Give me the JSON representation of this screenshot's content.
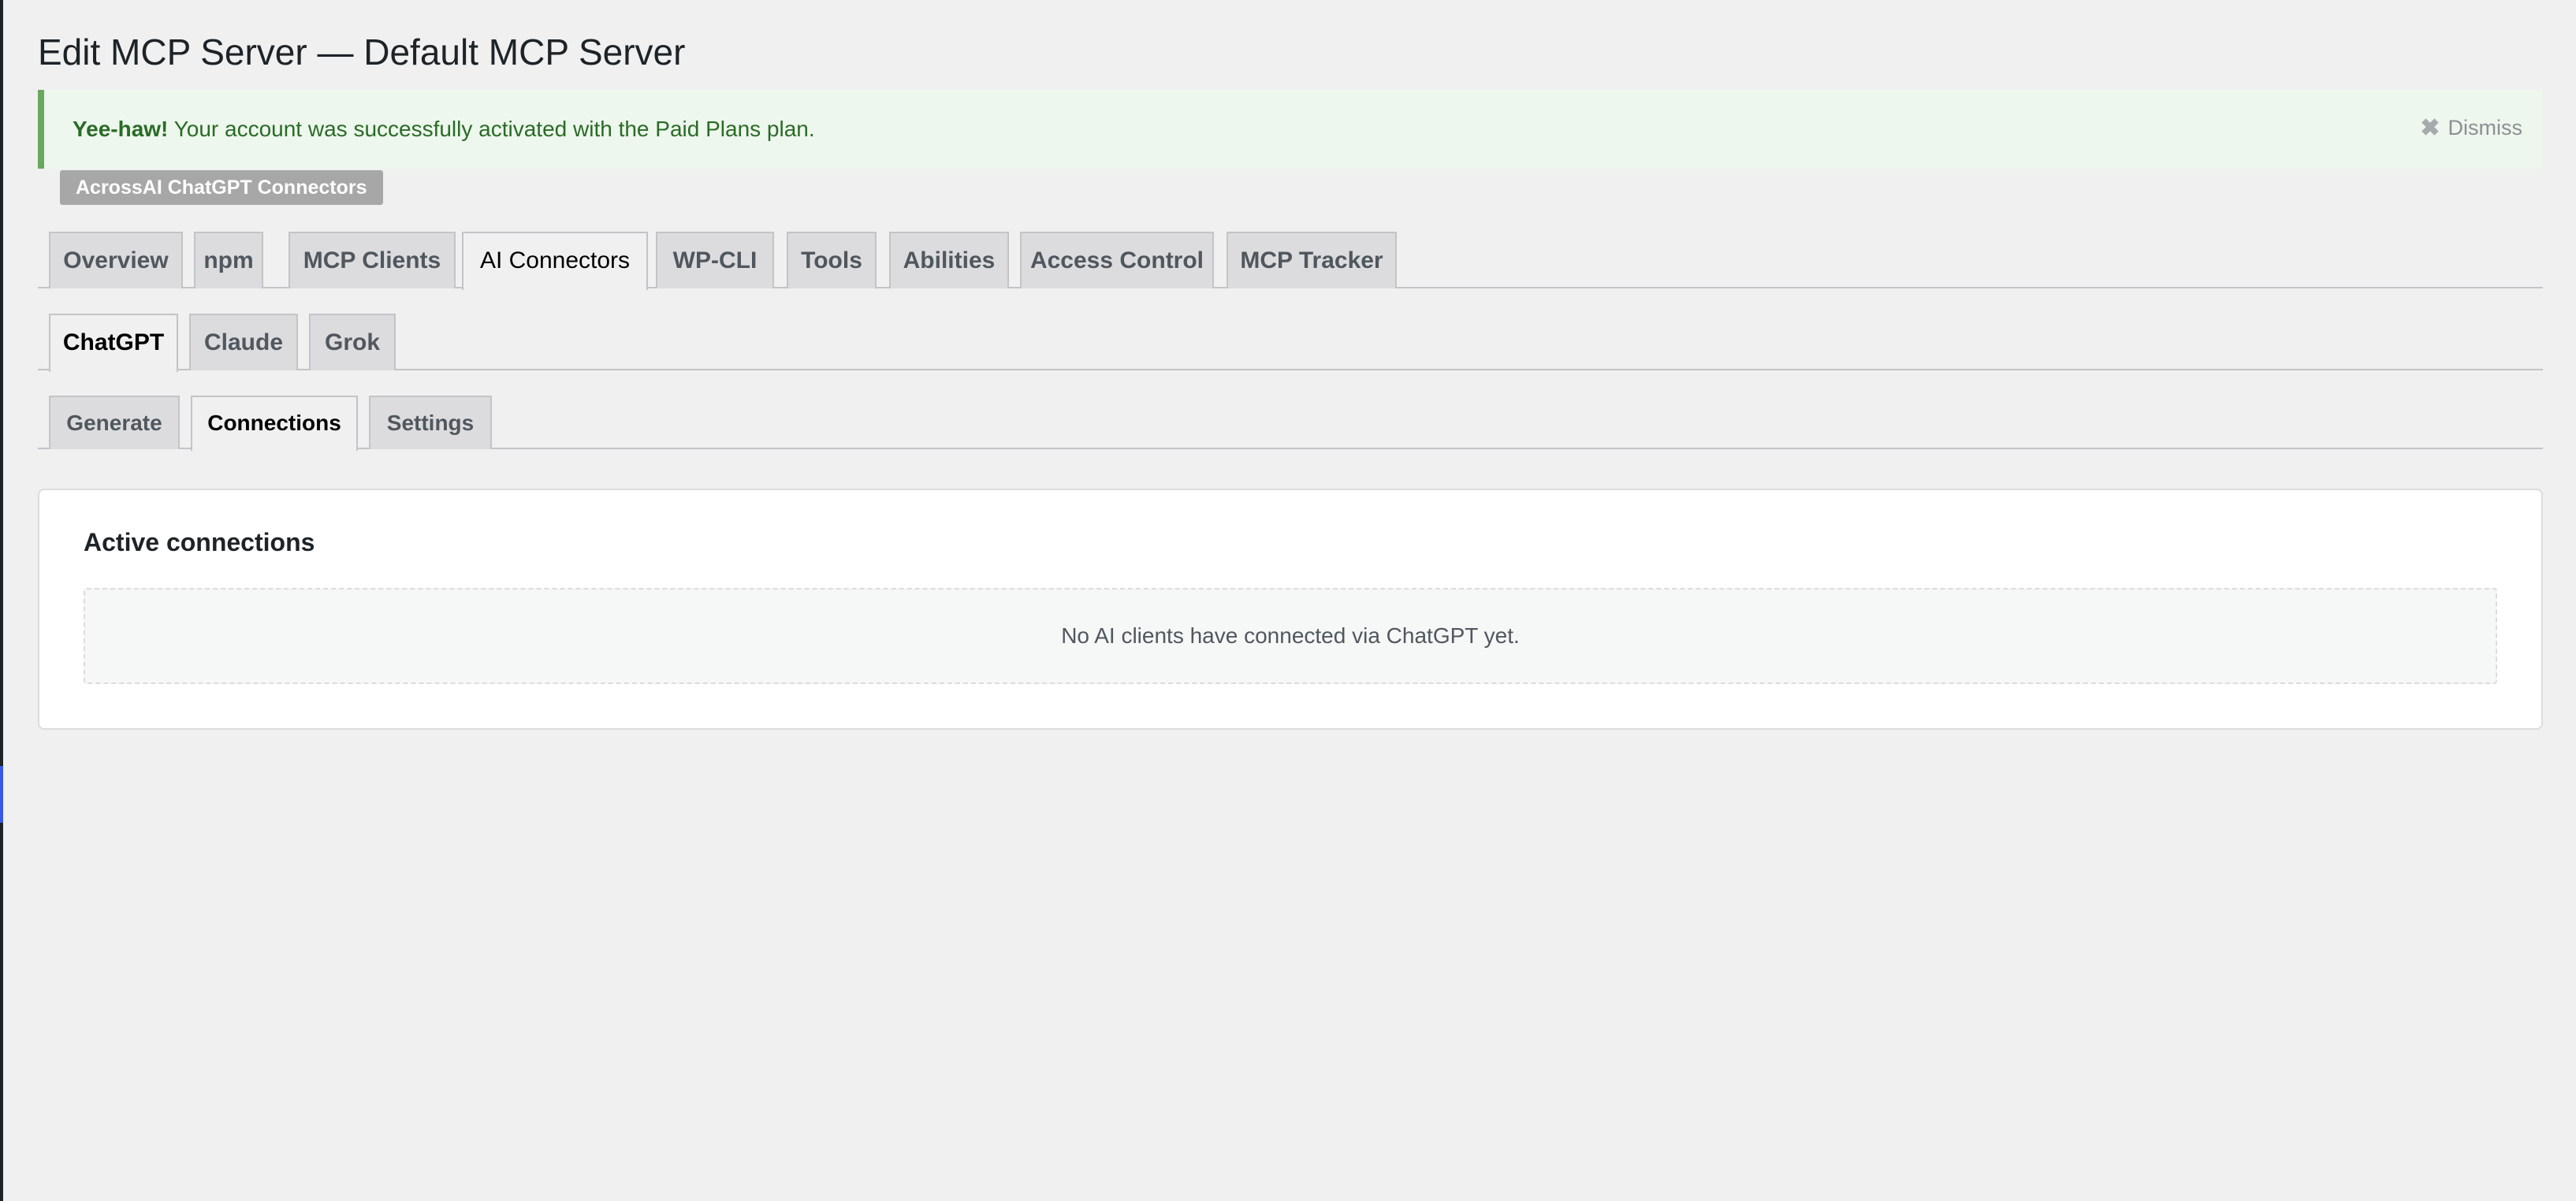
{
  "page": {
    "title": "Edit MCP Server — Default MCP Server"
  },
  "notice": {
    "strong": "Yee-haw!",
    "message": " Your account was successfully activated with the Paid Plans plan.",
    "dismiss_label": "Dismiss",
    "dismiss_icon": "close-icon",
    "accent_color": "#68a95f"
  },
  "plugin_badge": "AcrossAI ChatGPT Connectors",
  "main_tabs": [
    {
      "label": "Overview",
      "active": false
    },
    {
      "label": "npm",
      "active": false
    },
    {
      "label": "MCP Clients",
      "active": false
    },
    {
      "label": "AI Connectors",
      "active": true
    },
    {
      "label": "WP-CLI",
      "active": false
    },
    {
      "label": "Tools",
      "active": false
    },
    {
      "label": "Abilities",
      "active": false
    },
    {
      "label": "Access Control",
      "active": false
    },
    {
      "label": "MCP Tracker",
      "active": false
    }
  ],
  "connector_tabs": [
    {
      "label": "ChatGPT",
      "active": true
    },
    {
      "label": "Claude",
      "active": false
    },
    {
      "label": "Grok",
      "active": false
    }
  ],
  "sub_tabs": [
    {
      "label": "Generate",
      "active": false
    },
    {
      "label": "Connections",
      "active": true
    },
    {
      "label": "Settings",
      "active": false
    }
  ],
  "connections": {
    "heading": "Active connections",
    "empty_message": "No AI clients have connected via ChatGPT yet."
  }
}
